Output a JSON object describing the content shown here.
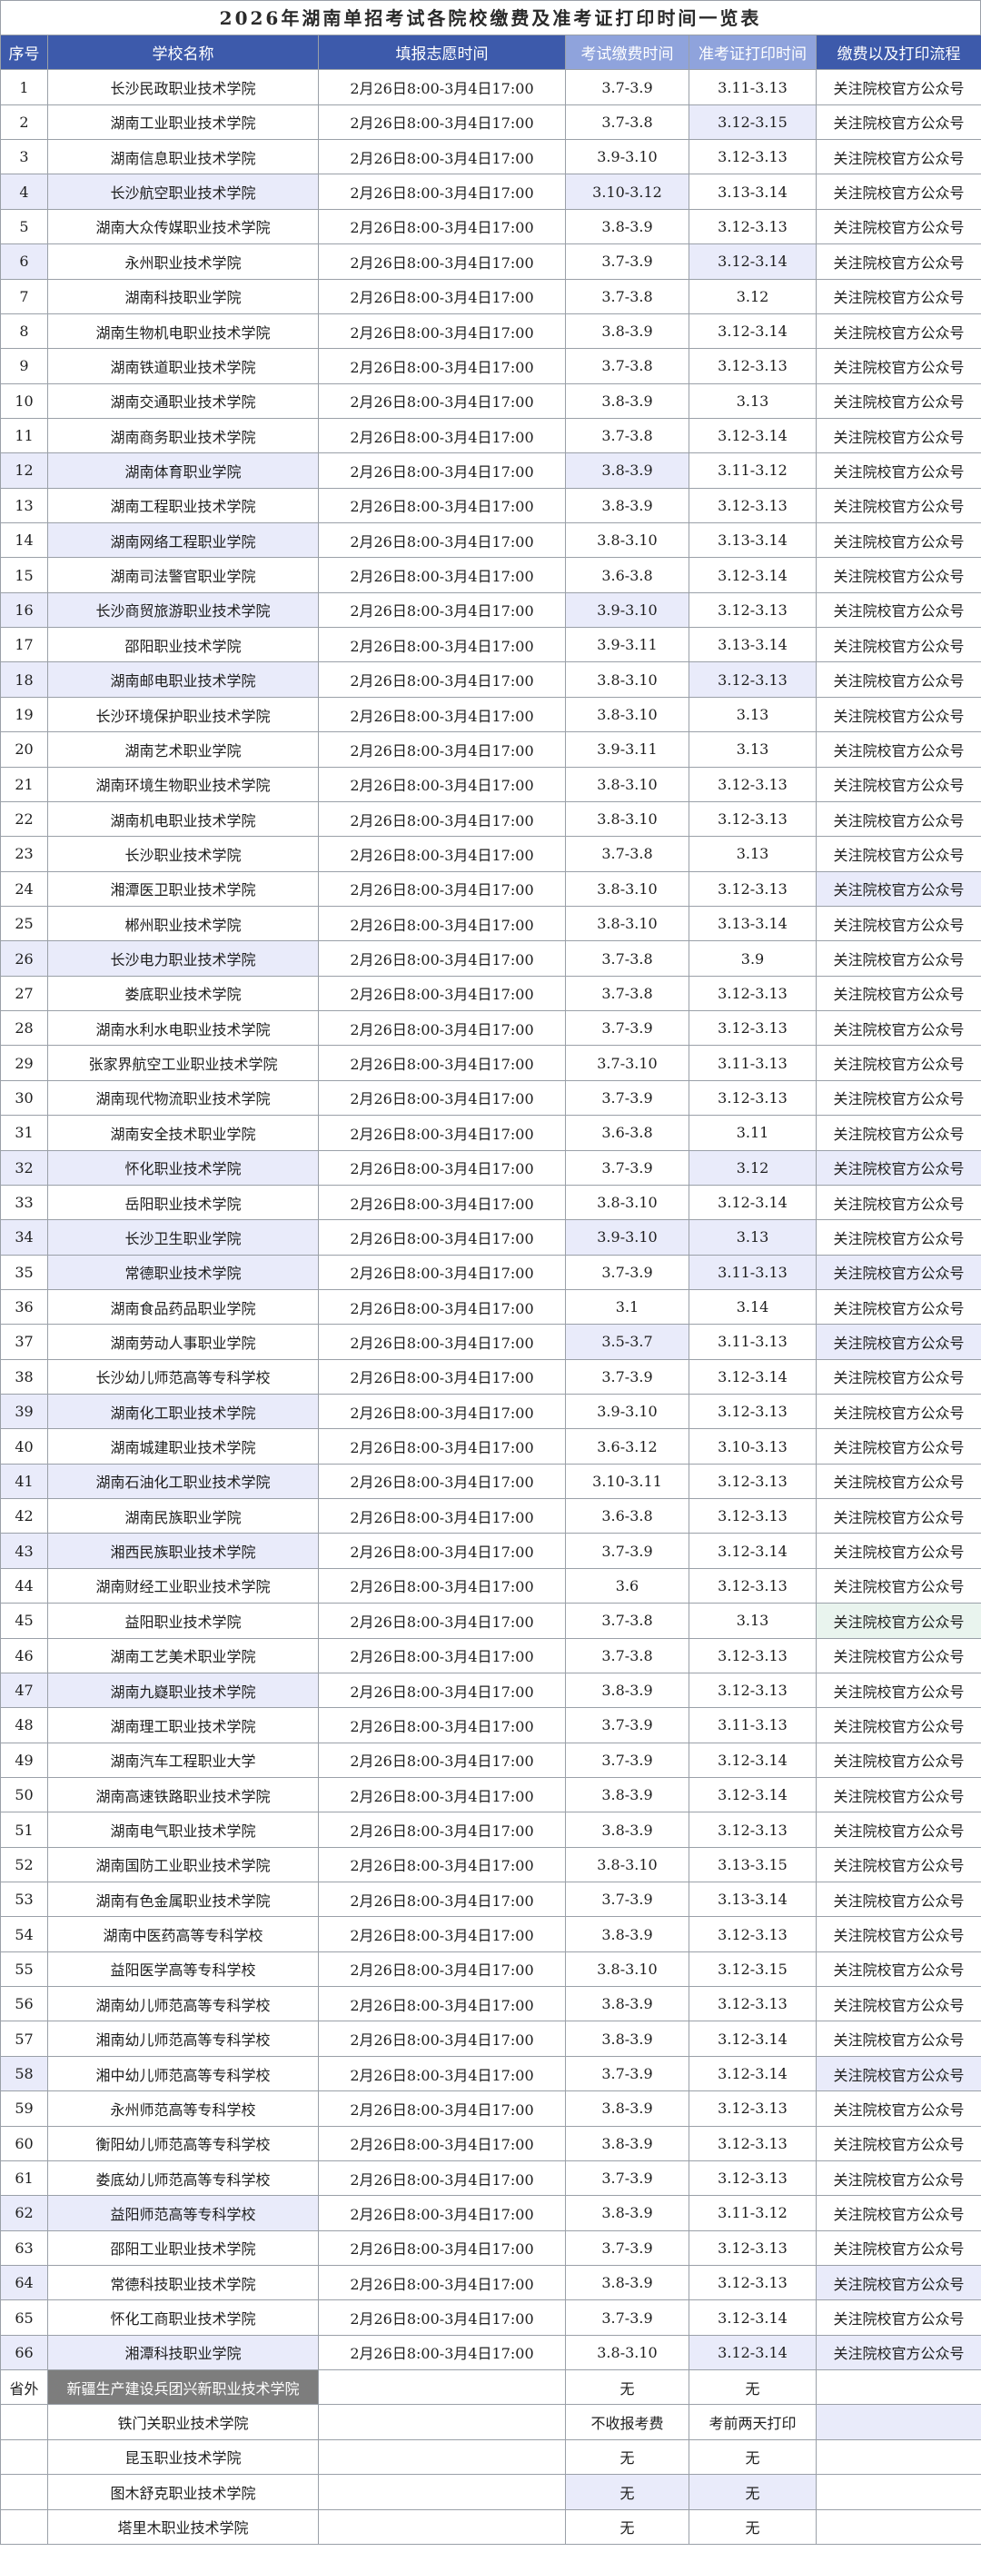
{
  "title": "2026年湖南单招考试各院校缴费及准考证打印时间一览表",
  "headers": {
    "no": "序号",
    "school": "学校名称",
    "fill": "填报志愿时间",
    "pay": "考试缴费时间",
    "print": "准考证打印时间",
    "process": "缴费以及打印流程"
  },
  "rows": [
    {
      "no": "1",
      "school": "长沙民政职业技术学院",
      "fill": "2月26日8:00-3月4日17:00",
      "pay": "3.7-3.9",
      "print": "3.11-3.13",
      "process": "关注院校官方公众号"
    },
    {
      "no": "2",
      "school": "湖南工业职业技术学院",
      "fill": "2月26日8:00-3月4日17:00",
      "pay": "3.7-3.8",
      "print": "3.12-3.15",
      "process": "关注院校官方公众号"
    },
    {
      "no": "3",
      "school": "湖南信息职业技术学院",
      "fill": "2月26日8:00-3月4日17:00",
      "pay": "3.9-3.10",
      "print": "3.12-3.13",
      "process": "关注院校官方公众号"
    },
    {
      "no": "4",
      "school": "长沙航空职业技术学院",
      "fill": "2月26日8:00-3月4日17:00",
      "pay": "3.10-3.12",
      "print": "3.13-3.14",
      "process": "关注院校官方公众号"
    },
    {
      "no": "5",
      "school": "湖南大众传媒职业技术学院",
      "fill": "2月26日8:00-3月4日17:00",
      "pay": "3.8-3.9",
      "print": "3.12-3.13",
      "process": "关注院校官方公众号"
    },
    {
      "no": "6",
      "school": "永州职业技术学院",
      "fill": "2月26日8:00-3月4日17:00",
      "pay": "3.7-3.9",
      "print": "3.12-3.14",
      "process": "关注院校官方公众号"
    },
    {
      "no": "7",
      "school": "湖南科技职业学院",
      "fill": "2月26日8:00-3月4日17:00",
      "pay": "3.7-3.8",
      "print": "3.12",
      "process": "关注院校官方公众号"
    },
    {
      "no": "8",
      "school": "湖南生物机电职业技术学院",
      "fill": "2月26日8:00-3月4日17:00",
      "pay": "3.8-3.9",
      "print": "3.12-3.14",
      "process": "关注院校官方公众号"
    },
    {
      "no": "9",
      "school": "湖南铁道职业技术学院",
      "fill": "2月26日8:00-3月4日17:00",
      "pay": "3.7-3.8",
      "print": "3.12-3.13",
      "process": "关注院校官方公众号"
    },
    {
      "no": "10",
      "school": "湖南交通职业技术学院",
      "fill": "2月26日8:00-3月4日17:00",
      "pay": "3.8-3.9",
      "print": "3.13",
      "process": "关注院校官方公众号"
    },
    {
      "no": "11",
      "school": "湖南商务职业技术学院",
      "fill": "2月26日8:00-3月4日17:00",
      "pay": "3.7-3.8",
      "print": "3.12-3.14",
      "process": "关注院校官方公众号"
    },
    {
      "no": "12",
      "school": "湖南体育职业学院",
      "fill": "2月26日8:00-3月4日17:00",
      "pay": "3.8-3.9",
      "print": "3.11-3.12",
      "process": "关注院校官方公众号"
    },
    {
      "no": "13",
      "school": "湖南工程职业技术学院",
      "fill": "2月26日8:00-3月4日17:00",
      "pay": "3.8-3.9",
      "print": "3.12-3.13",
      "process": "关注院校官方公众号"
    },
    {
      "no": "14",
      "school": "湖南网络工程职业学院",
      "fill": "2月26日8:00-3月4日17:00",
      "pay": "3.8-3.10",
      "print": "3.13-3.14",
      "process": "关注院校官方公众号"
    },
    {
      "no": "15",
      "school": "湖南司法警官职业学院",
      "fill": "2月26日8:00-3月4日17:00",
      "pay": "3.6-3.8",
      "print": "3.12-3.14",
      "process": "关注院校官方公众号"
    },
    {
      "no": "16",
      "school": "长沙商贸旅游职业技术学院",
      "fill": "2月26日8:00-3月4日17:00",
      "pay": "3.9-3.10",
      "print": "3.12-3.13",
      "process": "关注院校官方公众号"
    },
    {
      "no": "17",
      "school": "邵阳职业技术学院",
      "fill": "2月26日8:00-3月4日17:00",
      "pay": "3.9-3.11",
      "print": "3.13-3.14",
      "process": "关注院校官方公众号"
    },
    {
      "no": "18",
      "school": "湖南邮电职业技术学院",
      "fill": "2月26日8:00-3月4日17:00",
      "pay": "3.8-3.10",
      "print": "3.12-3.13",
      "process": "关注院校官方公众号"
    },
    {
      "no": "19",
      "school": "长沙环境保护职业技术学院",
      "fill": "2月26日8:00-3月4日17:00",
      "pay": "3.8-3.10",
      "print": "3.13",
      "process": "关注院校官方公众号"
    },
    {
      "no": "20",
      "school": "湖南艺术职业学院",
      "fill": "2月26日8:00-3月4日17:00",
      "pay": "3.9-3.11",
      "print": "3.13",
      "process": "关注院校官方公众号"
    },
    {
      "no": "21",
      "school": "湖南环境生物职业技术学院",
      "fill": "2月26日8:00-3月4日17:00",
      "pay": "3.8-3.10",
      "print": "3.12-3.13",
      "process": "关注院校官方公众号"
    },
    {
      "no": "22",
      "school": "湖南机电职业技术学院",
      "fill": "2月26日8:00-3月4日17:00",
      "pay": "3.8-3.10",
      "print": "3.12-3.13",
      "process": "关注院校官方公众号"
    },
    {
      "no": "23",
      "school": "长沙职业技术学院",
      "fill": "2月26日8:00-3月4日17:00",
      "pay": "3.7-3.8",
      "print": "3.13",
      "process": "关注院校官方公众号"
    },
    {
      "no": "24",
      "school": "湘潭医卫职业技术学院",
      "fill": "2月26日8:00-3月4日17:00",
      "pay": "3.8-3.10",
      "print": "3.12-3.13",
      "process": "关注院校官方公众号"
    },
    {
      "no": "25",
      "school": "郴州职业技术学院",
      "fill": "2月26日8:00-3月4日17:00",
      "pay": "3.8-3.10",
      "print": "3.13-3.14",
      "process": "关注院校官方公众号"
    },
    {
      "no": "26",
      "school": "长沙电力职业技术学院",
      "fill": "2月26日8:00-3月4日17:00",
      "pay": "3.7-3.8",
      "print": "3.9",
      "process": "关注院校官方公众号"
    },
    {
      "no": "27",
      "school": "娄底职业技术学院",
      "fill": "2月26日8:00-3月4日17:00",
      "pay": "3.7-3.8",
      "print": "3.12-3.13",
      "process": "关注院校官方公众号"
    },
    {
      "no": "28",
      "school": "湖南水利水电职业技术学院",
      "fill": "2月26日8:00-3月4日17:00",
      "pay": "3.7-3.9",
      "print": "3.12-3.13",
      "process": "关注院校官方公众号"
    },
    {
      "no": "29",
      "school": "张家界航空工业职业技术学院",
      "fill": "2月26日8:00-3月4日17:00",
      "pay": "3.7-3.10",
      "print": "3.11-3.13",
      "process": "关注院校官方公众号"
    },
    {
      "no": "30",
      "school": "湖南现代物流职业技术学院",
      "fill": "2月26日8:00-3月4日17:00",
      "pay": "3.7-3.9",
      "print": "3.12-3.13",
      "process": "关注院校官方公众号"
    },
    {
      "no": "31",
      "school": "湖南安全技术职业学院",
      "fill": "2月26日8:00-3月4日17:00",
      "pay": "3.6-3.8",
      "print": "3.11",
      "process": "关注院校官方公众号"
    },
    {
      "no": "32",
      "school": "怀化职业技术学院",
      "fill": "2月26日8:00-3月4日17:00",
      "pay": "3.7-3.9",
      "print": "3.12",
      "process": "关注院校官方公众号"
    },
    {
      "no": "33",
      "school": "岳阳职业技术学院",
      "fill": "2月26日8:00-3月4日17:00",
      "pay": "3.8-3.10",
      "print": "3.12-3.14",
      "process": "关注院校官方公众号"
    },
    {
      "no": "34",
      "school": "长沙卫生职业学院",
      "fill": "2月26日8:00-3月4日17:00",
      "pay": "3.9-3.10",
      "print": "3.13",
      "process": "关注院校官方公众号"
    },
    {
      "no": "35",
      "school": "常德职业技术学院",
      "fill": "2月26日8:00-3月4日17:00",
      "pay": "3.7-3.9",
      "print": "3.11-3.13",
      "process": "关注院校官方公众号"
    },
    {
      "no": "36",
      "school": "湖南食品药品职业学院",
      "fill": "2月26日8:00-3月4日17:00",
      "pay": "3.1",
      "print": "3.14",
      "process": "关注院校官方公众号"
    },
    {
      "no": "37",
      "school": "湖南劳动人事职业学院",
      "fill": "2月26日8:00-3月4日17:00",
      "pay": "3.5-3.7",
      "print": "3.11-3.13",
      "process": "关注院校官方公众号"
    },
    {
      "no": "38",
      "school": "长沙幼儿师范高等专科学校",
      "fill": "2月26日8:00-3月4日17:00",
      "pay": "3.7-3.9",
      "print": "3.12-3.14",
      "process": "关注院校官方公众号"
    },
    {
      "no": "39",
      "school": "湖南化工职业技术学院",
      "fill": "2月26日8:00-3月4日17:00",
      "pay": "3.9-3.10",
      "print": "3.12-3.13",
      "process": "关注院校官方公众号"
    },
    {
      "no": "40",
      "school": "湖南城建职业技术学院",
      "fill": "2月26日8:00-3月4日17:00",
      "pay": "3.6-3.12",
      "print": "3.10-3.13",
      "process": "关注院校官方公众号"
    },
    {
      "no": "41",
      "school": "湖南石油化工职业技术学院",
      "fill": "2月26日8:00-3月4日17:00",
      "pay": "3.10-3.11",
      "print": "3.12-3.13",
      "process": "关注院校官方公众号"
    },
    {
      "no": "42",
      "school": "湖南民族职业学院",
      "fill": "2月26日8:00-3月4日17:00",
      "pay": "3.6-3.8",
      "print": "3.12-3.13",
      "process": "关注院校官方公众号"
    },
    {
      "no": "43",
      "school": "湘西民族职业技术学院",
      "fill": "2月26日8:00-3月4日17:00",
      "pay": "3.7-3.9",
      "print": "3.12-3.14",
      "process": "关注院校官方公众号"
    },
    {
      "no": "44",
      "school": "湖南财经工业职业技术学院",
      "fill": "2月26日8:00-3月4日17:00",
      "pay": "3.6",
      "print": "3.12-3.13",
      "process": "关注院校官方公众号"
    },
    {
      "no": "45",
      "school": "益阳职业技术学院",
      "fill": "2月26日8:00-3月4日17:00",
      "pay": "3.7-3.8",
      "print": "3.13",
      "process": "关注院校官方公众号"
    },
    {
      "no": "46",
      "school": "湖南工艺美术职业学院",
      "fill": "2月26日8:00-3月4日17:00",
      "pay": "3.7-3.8",
      "print": "3.12-3.13",
      "process": "关注院校官方公众号"
    },
    {
      "no": "47",
      "school": "湖南九嶷职业技术学院",
      "fill": "2月26日8:00-3月4日17:00",
      "pay": "3.8-3.9",
      "print": "3.12-3.13",
      "process": "关注院校官方公众号"
    },
    {
      "no": "48",
      "school": "湖南理工职业技术学院",
      "fill": "2月26日8:00-3月4日17:00",
      "pay": "3.7-3.9",
      "print": "3.11-3.13",
      "process": "关注院校官方公众号"
    },
    {
      "no": "49",
      "school": "湖南汽车工程职业大学",
      "fill": "2月26日8:00-3月4日17:00",
      "pay": "3.7-3.9",
      "print": "3.12-3.14",
      "process": "关注院校官方公众号"
    },
    {
      "no": "50",
      "school": "湖南高速铁路职业技术学院",
      "fill": "2月26日8:00-3月4日17:00",
      "pay": "3.8-3.9",
      "print": "3.12-3.14",
      "process": "关注院校官方公众号"
    },
    {
      "no": "51",
      "school": "湖南电气职业技术学院",
      "fill": "2月26日8:00-3月4日17:00",
      "pay": "3.8-3.9",
      "print": "3.12-3.13",
      "process": "关注院校官方公众号"
    },
    {
      "no": "52",
      "school": "湖南国防工业职业技术学院",
      "fill": "2月26日8:00-3月4日17:00",
      "pay": "3.8-3.10",
      "print": "3.13-3.15",
      "process": "关注院校官方公众号"
    },
    {
      "no": "53",
      "school": "湖南有色金属职业技术学院",
      "fill": "2月26日8:00-3月4日17:00",
      "pay": "3.7-3.9",
      "print": "3.13-3.14",
      "process": "关注院校官方公众号"
    },
    {
      "no": "54",
      "school": "湖南中医药高等专科学校",
      "fill": "2月26日8:00-3月4日17:00",
      "pay": "3.8-3.9",
      "print": "3.12-3.13",
      "process": "关注院校官方公众号"
    },
    {
      "no": "55",
      "school": "益阳医学高等专科学校",
      "fill": "2月26日8:00-3月4日17:00",
      "pay": "3.8-3.10",
      "print": "3.12-3.15",
      "process": "关注院校官方公众号"
    },
    {
      "no": "56",
      "school": "湖南幼儿师范高等专科学校",
      "fill": "2月26日8:00-3月4日17:00",
      "pay": "3.8-3.9",
      "print": "3.12-3.13",
      "process": "关注院校官方公众号"
    },
    {
      "no": "57",
      "school": "湘南幼儿师范高等专科学校",
      "fill": "2月26日8:00-3月4日17:00",
      "pay": "3.8-3.9",
      "print": "3.12-3.14",
      "process": "关注院校官方公众号"
    },
    {
      "no": "58",
      "school": "湘中幼儿师范高等专科学校",
      "fill": "2月26日8:00-3月4日17:00",
      "pay": "3.7-3.9",
      "print": "3.12-3.14",
      "process": "关注院校官方公众号"
    },
    {
      "no": "59",
      "school": "永州师范高等专科学校",
      "fill": "2月26日8:00-3月4日17:00",
      "pay": "3.8-3.9",
      "print": "3.12-3.13",
      "process": "关注院校官方公众号"
    },
    {
      "no": "60",
      "school": "衡阳幼儿师范高等专科学校",
      "fill": "2月26日8:00-3月4日17:00",
      "pay": "3.8-3.9",
      "print": "3.12-3.13",
      "process": "关注院校官方公众号"
    },
    {
      "no": "61",
      "school": "娄底幼儿师范高等专科学校",
      "fill": "2月26日8:00-3月4日17:00",
      "pay": "3.7-3.9",
      "print": "3.12-3.13",
      "process": "关注院校官方公众号"
    },
    {
      "no": "62",
      "school": "益阳师范高等专科学校",
      "fill": "2月26日8:00-3月4日17:00",
      "pay": "3.8-3.9",
      "print": "3.11-3.12",
      "process": "关注院校官方公众号"
    },
    {
      "no": "63",
      "school": "邵阳工业职业技术学院",
      "fill": "2月26日8:00-3月4日17:00",
      "pay": "3.7-3.9",
      "print": "3.12-3.13",
      "process": "关注院校官方公众号"
    },
    {
      "no": "64",
      "school": "常德科技职业技术学院",
      "fill": "2月26日8:00-3月4日17:00",
      "pay": "3.8-3.9",
      "print": "3.12-3.13",
      "process": "关注院校官方公众号"
    },
    {
      "no": "65",
      "school": "怀化工商职业技术学院",
      "fill": "2月26日8:00-3月4日17:00",
      "pay": "3.7-3.9",
      "print": "3.12-3.14",
      "process": "关注院校官方公众号"
    },
    {
      "no": "66",
      "school": "湘潭科技职业学院",
      "fill": "2月26日8:00-3月4日17:00",
      "pay": "3.8-3.10",
      "print": "3.12-3.14",
      "process": "关注院校官方公众号"
    }
  ],
  "outside": {
    "label": "省外",
    "rows": [
      {
        "school": "新疆生产建设兵团兴新职业技术学院",
        "fill": "",
        "pay": "无",
        "print": "无",
        "process": ""
      },
      {
        "school": "铁门关职业技术学院",
        "fill": "",
        "pay": "不收报考费",
        "print": "考前两天打印",
        "process": ""
      },
      {
        "school": "昆玉职业技术学院",
        "fill": "",
        "pay": "无",
        "print": "无",
        "process": ""
      },
      {
        "school": "图木舒克职业技术学院",
        "fill": "",
        "pay": "无",
        "print": "无",
        "process": ""
      },
      {
        "school": "塔里木职业技术学院",
        "fill": "",
        "pay": "无",
        "print": "无",
        "process": ""
      }
    ]
  },
  "colors": {
    "header_bg": "#3d5aab",
    "header_highlight": "#8fa3dc",
    "cell_highlight": "#e9ebfa",
    "cell_highlight_green": "#e9f4ee",
    "dark_cell": "#7d7d7d"
  }
}
